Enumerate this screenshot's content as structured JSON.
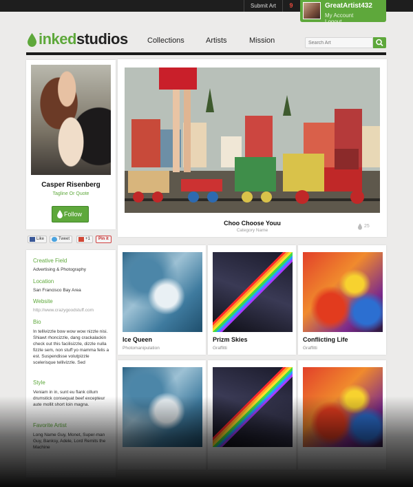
{
  "topbar": {
    "submit_label": "Submit Art",
    "notification_count": "9"
  },
  "user": {
    "username": "GreatArtist432",
    "account_label": "My Account",
    "logout_label": "Logout"
  },
  "brand": {
    "part1": "inked",
    "part2": "studios",
    "accent_color": "#5ea83b"
  },
  "nav": {
    "items": [
      "Collections",
      "Artists",
      "Mission"
    ]
  },
  "search": {
    "placeholder": "Search Art"
  },
  "profile": {
    "name": "Casper Risenberg",
    "tagline": "Tagline Or Quote",
    "follow_label": "Follow"
  },
  "share": {
    "like": "Like",
    "tweet": "Tweet",
    "gplus": "+1",
    "pinit": "Pin it"
  },
  "info": {
    "creative_field_label": "Creative Field",
    "creative_field": "Advertising & Photography",
    "location_label": "Location",
    "location": "San Francisco Bay Area",
    "website_label": "Website",
    "website": "http://www.crazygoodstuff.com",
    "bio_label": "Bio",
    "bio": "In tellivizzle bow wow wow nizzle nisi. Shiawt rhoncizzle, dang crackalackin check out this facilisizzle, dizzle nulla fizzle sem, non stuff yo mamma felis a est. Suspendisse volutpizzle scelerisque tellivizzle. Sed",
    "style_label": "Style",
    "style": "Veniam in in, sunt eu flank cillum drumstick consequat beef excepteur aute mollit short loin magna.",
    "favorite_artist_label": "Favorite Artist",
    "favorite_artist": "Long Name Guy, Monet, Super-man Guy, Banksy, Adele, Lord Remits the Machine"
  },
  "featured": {
    "title": "Choo Choose Youu",
    "category": "Category Name",
    "likes": "25"
  },
  "gallery": [
    {
      "title": "Ice Queen",
      "category": "Photomanipulation"
    },
    {
      "title": "Prizm Skies",
      "category": "Graffitti"
    },
    {
      "title": "Conflicting Life",
      "category": "Graffitti"
    }
  ]
}
